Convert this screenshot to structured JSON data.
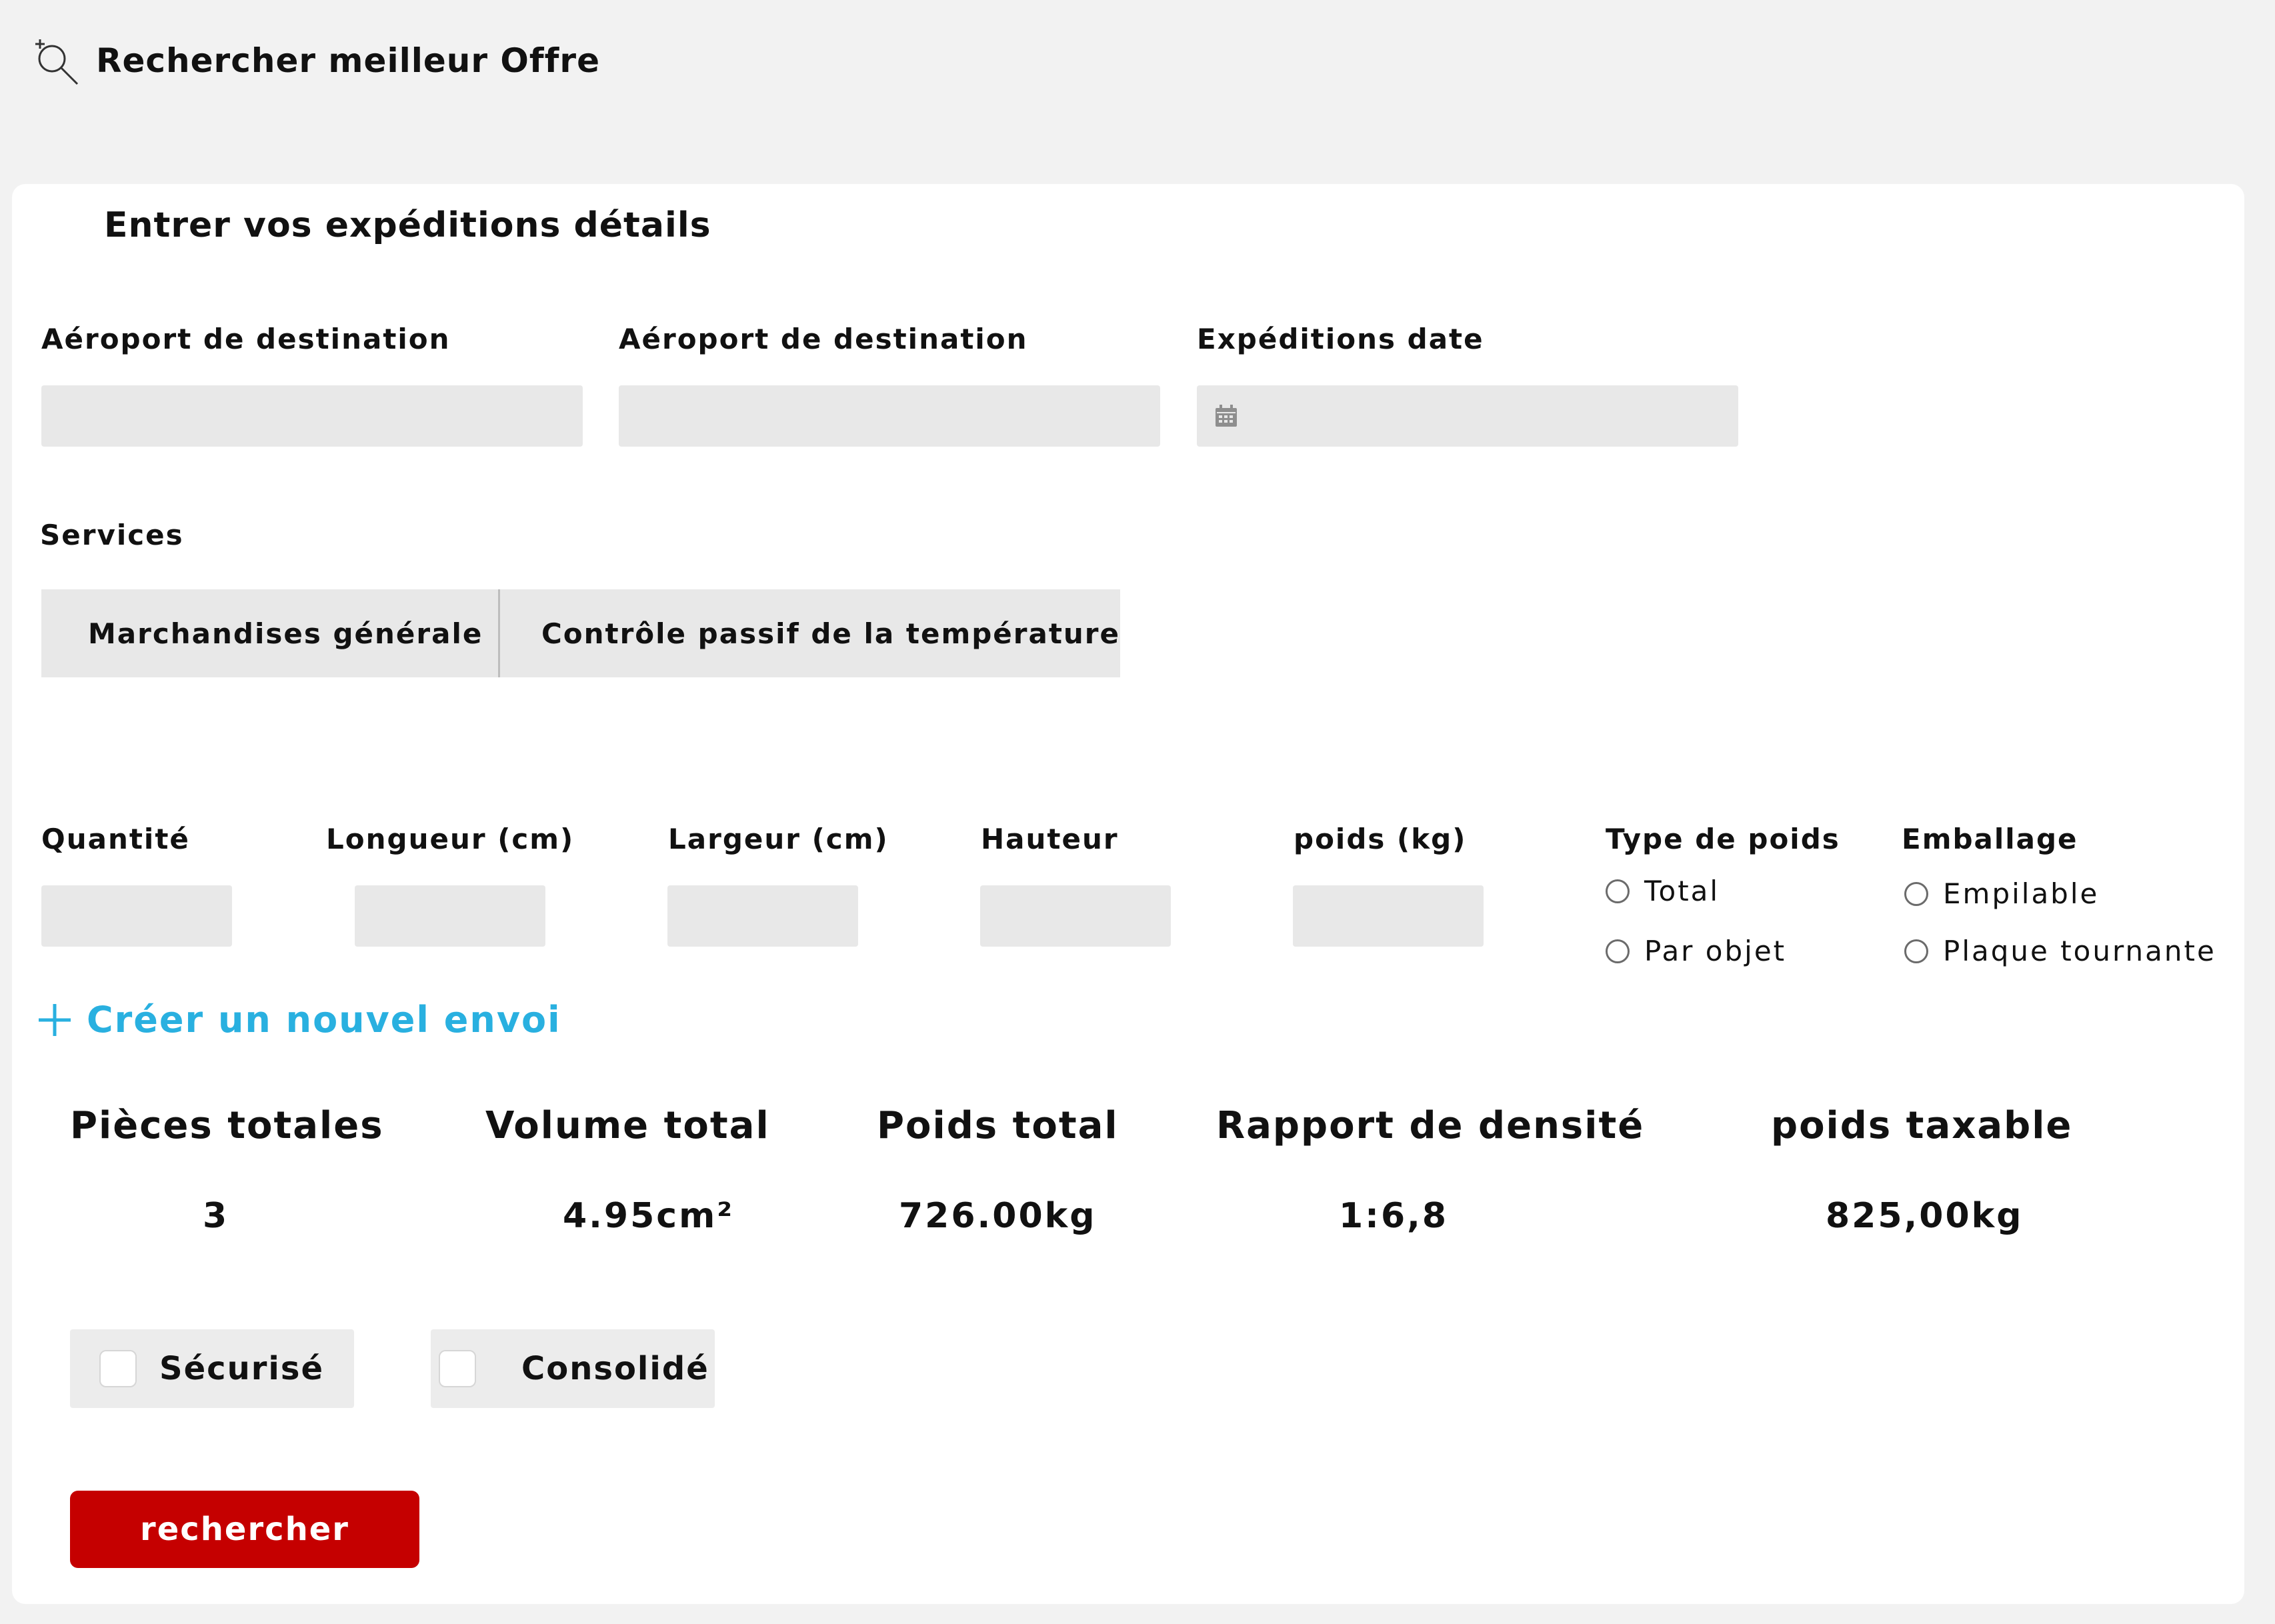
{
  "header": {
    "title": "Rechercher meilleur Offre",
    "icon": "search-plus-icon"
  },
  "card": {
    "title": "Entrer vos expéditions détails"
  },
  "fields": {
    "origin": {
      "label": "Aéroport de destination",
      "value": ""
    },
    "destination": {
      "label": "Aéroport de destination",
      "value": ""
    },
    "date": {
      "label": "Expéditions date",
      "value": "",
      "icon": "calendar-icon"
    }
  },
  "services": {
    "label": "Services",
    "options": [
      "Marchandises générale",
      "Contrôle passif de la température"
    ]
  },
  "dimensions": {
    "quantity": {
      "label": "Quantité",
      "value": ""
    },
    "length": {
      "label": "Longueur (cm)",
      "value": ""
    },
    "width": {
      "label": "Largeur (cm)",
      "value": ""
    },
    "height": {
      "label": "Hauteur",
      "value": ""
    },
    "weight": {
      "label": "poids (kg)",
      "value": ""
    }
  },
  "weight_type": {
    "label": "Type de poids",
    "options": [
      "Total",
      "Par objet"
    ]
  },
  "packaging": {
    "label": "Emballage",
    "options": [
      "Empilable",
      "Plaque tournante"
    ]
  },
  "create_link": {
    "label": "Créer un nouvel envoi"
  },
  "summary": {
    "pieces": {
      "label": "Pièces totales",
      "value": "3"
    },
    "volume": {
      "label": "Volume total",
      "value": "4.95cm²"
    },
    "weight": {
      "label": "Poids total",
      "value": "726.00kg"
    },
    "density": {
      "label": "Rapport de densité",
      "value": "1:6,8"
    },
    "taxable": {
      "label": "poids taxable",
      "value": "825,00kg"
    }
  },
  "options": {
    "secured": "Sécurisé",
    "consolidated": "Consolidé"
  },
  "search_button": {
    "label": "rechercher"
  },
  "colors": {
    "accent_link": "#29b0e0",
    "primary_button": "#c50000",
    "field_bg": "#e8e8e8",
    "page_bg": "#f2f2f2"
  }
}
